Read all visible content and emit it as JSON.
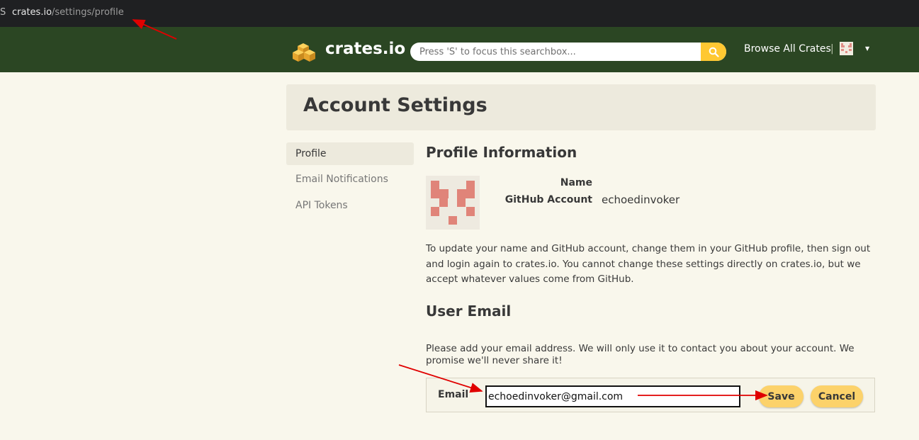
{
  "browser": {
    "url_host": "crates.io",
    "url_path": "/settings/profile"
  },
  "header": {
    "brand": "crates.io",
    "search_placeholder": "Press 'S' to focus this searchbox...",
    "browse": "Browse All Crates",
    "separator": "|",
    "accent": "#ffc832",
    "bg": "#2b4623"
  },
  "page": {
    "title": "Account Settings"
  },
  "sidebar": {
    "items": [
      {
        "label": "Profile",
        "active": true
      },
      {
        "label": "Email Notifications",
        "active": false
      },
      {
        "label": "API Tokens",
        "active": false
      }
    ]
  },
  "profile": {
    "heading": "Profile Information",
    "name_label": "Name",
    "github_label": "GitHub Account",
    "github_value": "echoedinvoker",
    "paragraph": "To update your name and GitHub account, change them in your GitHub profile, then sign out and login again to crates.io. You cannot change these settings directly on crates.io, but we accept whatever values come from GitHub."
  },
  "email": {
    "heading": "User Email",
    "paragraph": "Please add your email address. We will only use it to contact you about your account. We promise we'll never share it!",
    "label": "Email",
    "value": "echoedinvoker@gmail.com",
    "save": "Save",
    "cancel": "Cancel"
  },
  "annotation_color": "#e00000"
}
